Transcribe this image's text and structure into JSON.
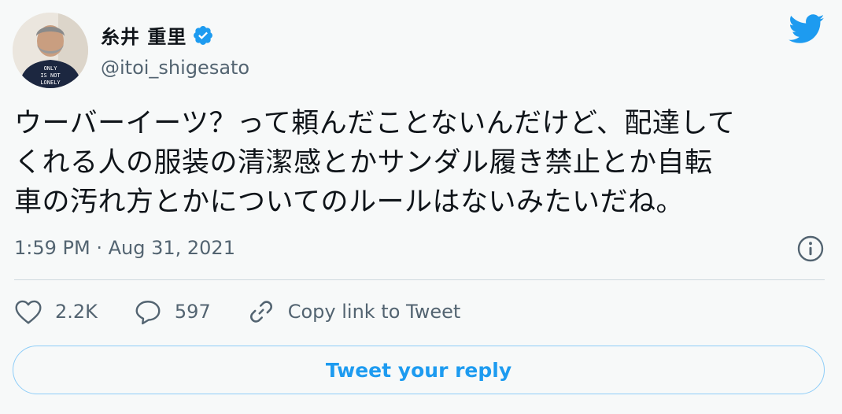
{
  "author": {
    "name": "糸井 重里",
    "handle": "@itoi_shigesato",
    "avatar_shirt_text": [
      "ONLY",
      "IS NOT",
      "LONELY"
    ]
  },
  "tweet": {
    "lines": [
      "ウーバーイーツ？って頼んだことないんだけど、配達して",
      "くれる人の服装の清潔感とかサンダル履き禁止とか自転",
      "車の汚れ方とかについてのルールはないみたいだね。"
    ],
    "timestamp": "1:59 PM · Aug 31, 2021"
  },
  "actions": {
    "like_count": "2.2K",
    "reply_count": "597",
    "copy_link_label": "Copy link to Tweet"
  },
  "reply_button_label": "Tweet your reply",
  "icons": {
    "brand": "twitter-bird-icon",
    "verified": "verified-badge-icon",
    "info": "info-icon",
    "like": "heart-icon",
    "reply": "comment-icon",
    "link": "link-icon"
  },
  "colors": {
    "accent": "#1d9bf0",
    "muted": "#536471",
    "text": "#0f1419"
  }
}
